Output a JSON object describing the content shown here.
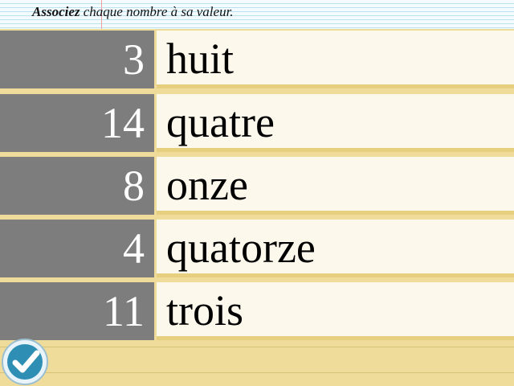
{
  "header": {
    "instruction_bold": "Associez",
    "instruction_rest": " chaque nombre à sa valeur."
  },
  "rows": [
    {
      "number": "3",
      "word": "huit"
    },
    {
      "number": "14",
      "word": "quatre"
    },
    {
      "number": "8",
      "word": "onze"
    },
    {
      "number": "4",
      "word": "quatorze"
    },
    {
      "number": "11",
      "word": "trois"
    }
  ],
  "icons": {
    "check": "check-icon"
  },
  "colors": {
    "number_bg": "#7d7d7d",
    "word_bg": "#fdf8ec",
    "page_bg": "#efdc9a",
    "check_blue": "#2f8eb3"
  }
}
